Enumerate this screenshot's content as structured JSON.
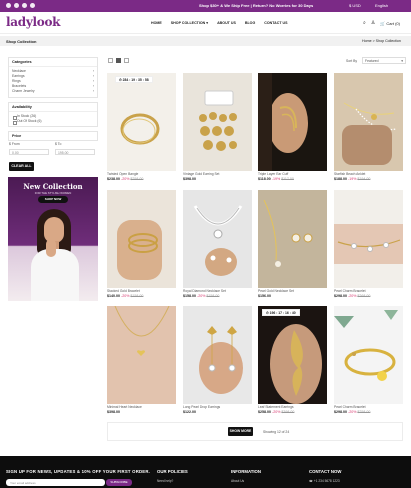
{
  "topbar": {
    "promo": "Shop $30+ & We Ship Free | Return? No Worries for 30 Days",
    "currency": "$ USD",
    "language": "English"
  },
  "header": {
    "logo": "ladylook",
    "nav": [
      "HOME",
      "SHOP COLLECTION",
      "ABOUT US",
      "BLOG",
      "CONTACT US"
    ],
    "cart": "Cart (0)"
  },
  "breadcrumb": {
    "title": "Shop Collection",
    "path": "Home  >  Shop Collection"
  },
  "sidebar": {
    "categories_title": "Categories",
    "categories": [
      "Necklace",
      "Earrings",
      "Rings",
      "Bracelets",
      "Charm Jewelry"
    ],
    "availability_title": "Availability",
    "availability": [
      "In Stock (26)",
      "Out Of Stock (6)"
    ],
    "price_title": "Price",
    "price_from_label": "$ From",
    "price_to_label": "$ To",
    "price_from": "0.00",
    "price_to": "195.00",
    "clear_all": "CLEAR ALL"
  },
  "banner": {
    "title": "New Collection",
    "subtitle": "FOR THE STYLISH WOMEN",
    "cta": "SHOP NOW"
  },
  "toolbar": {
    "sort_label": "Sort By",
    "sort_value": "Featured"
  },
  "products": [
    {
      "name": "Twisted Open Bangle",
      "price": "$238.00",
      "discount": "-20%",
      "old": "$258.00",
      "timer": "284 : 19 : 35 : 58"
    },
    {
      "name": "Vintage Gold Earring Set",
      "price": "$398.00",
      "discount": "",
      "old": "",
      "timer": ""
    },
    {
      "name": "Triple Layer Ear Cuff",
      "price": "$118.00",
      "discount": "-19%",
      "old": "$117.00",
      "timer": ""
    },
    {
      "name": "Starfish Beach Anklet",
      "price": "$188.00",
      "discount": "-19%",
      "old": "$194.00",
      "timer": ""
    },
    {
      "name": "Stacked Gold Bracelet",
      "price": "$140.00",
      "discount": "-20%",
      "old": "$158.00",
      "timer": ""
    },
    {
      "name": "Royal Diamond Necklace Set",
      "price": "$158.00",
      "discount": "-20%",
      "old": "$158.00",
      "timer": ""
    },
    {
      "name": "Pearl Gold Necklace Set",
      "price": "$156.00",
      "discount": "",
      "old": "",
      "timer": ""
    },
    {
      "name": "Pearl Charm Bracelet",
      "price": "$298.00",
      "discount": "-20%",
      "old": "$268.00",
      "timer": ""
    },
    {
      "name": "Minimal Heart Necklace",
      "price": "$398.00",
      "discount": "",
      "old": "",
      "timer": ""
    },
    {
      "name": "Long Pearl Drop Earrings",
      "price": "$122.00",
      "discount": "",
      "old": "",
      "timer": ""
    },
    {
      "name": "Leaf Statement Earrings",
      "price": "$258.00",
      "discount": "-20%",
      "old": "$398.00",
      "timer": "196 : 17 : 16 : 40"
    },
    {
      "name": "Pearl Charm Bracelet",
      "price": "$298.00",
      "discount": "-20%",
      "old": "$258.00",
      "timer": ""
    }
  ],
  "pagination": {
    "show_more": "SHOW MORE",
    "showing": "Showing 12 of 24"
  },
  "footer": {
    "newsletter": "SIGN UP FOR NEWS, UPDATES & 10% OFF YOUR FIRST ORDER.",
    "email_placeholder": "Your email address",
    "subscribe": "SUBSCRIBE",
    "policies": "OUR POLICIES",
    "policies_link": "Need help?",
    "information": "INFORMATION",
    "information_link": "About Us",
    "contact": "CONTACT NOW",
    "phone": "+1 234 5678 1223"
  }
}
